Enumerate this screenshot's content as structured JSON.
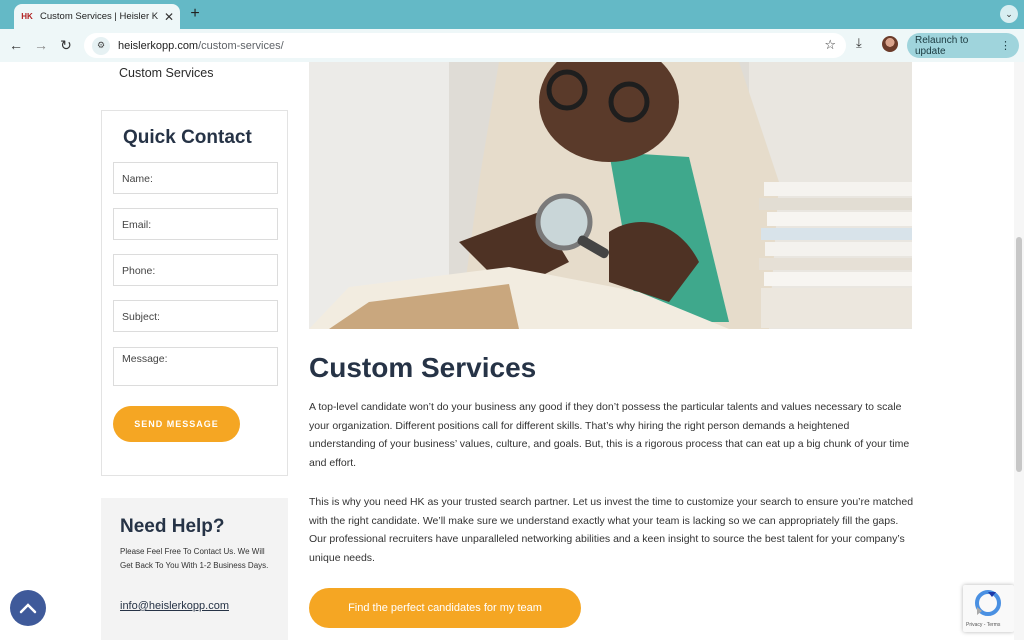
{
  "browser": {
    "tab_title": "Custom Services | Heisler Kopp",
    "tab_favicon": "HK",
    "new_tab": "+",
    "url_host": "heislerkopp.com",
    "url_path": "/custom-services/",
    "relaunch_label": "Relaunch to update"
  },
  "sidebar": {
    "prev_link": "Custom Services",
    "quick_contact": {
      "title": "Quick Contact",
      "name_placeholder": "Name:",
      "email_placeholder": "Email:",
      "phone_placeholder": "Phone:",
      "subject_placeholder": "Subject:",
      "message_placeholder": "Message:",
      "send_label": "SEND MESSAGE"
    },
    "need_help": {
      "title": "Need Help?",
      "text": "Please Feel Free To Contact Us. We Will Get Back To You With 1-2 Business Days.",
      "email": "info@heislerkopp.com"
    }
  },
  "main": {
    "title": "Custom Services",
    "paragraph1": "A top-level candidate won’t do your business any good if they don’t possess the particular talents and values necessary to scale your organization. Different positions call for different skills. That’s why hiring the right person demands a heightened understanding of your business’ values, culture, and goals. But, this is a rigorous process that can eat up a big chunk of your time and effort.",
    "paragraph2": "This is why you need HK as your trusted search partner. Let us invest the time to customize your search to ensure you’re matched with the right candidate. We’ll make sure we understand exactly what your team is lacking so we can appropriately fill the gaps. Our professional recruiters have unparalleled networking abilities and a keen insight to source the best talent for your company’s unique needs.",
    "cta_label": "Find the perfect candidates for my team"
  },
  "recaptcha": {
    "text": "Privacy - Terms"
  },
  "colors": {
    "accent": "#f5a623",
    "heading": "#263346",
    "chrome": "#64b9c6",
    "to_top": "#3f5a9a"
  }
}
